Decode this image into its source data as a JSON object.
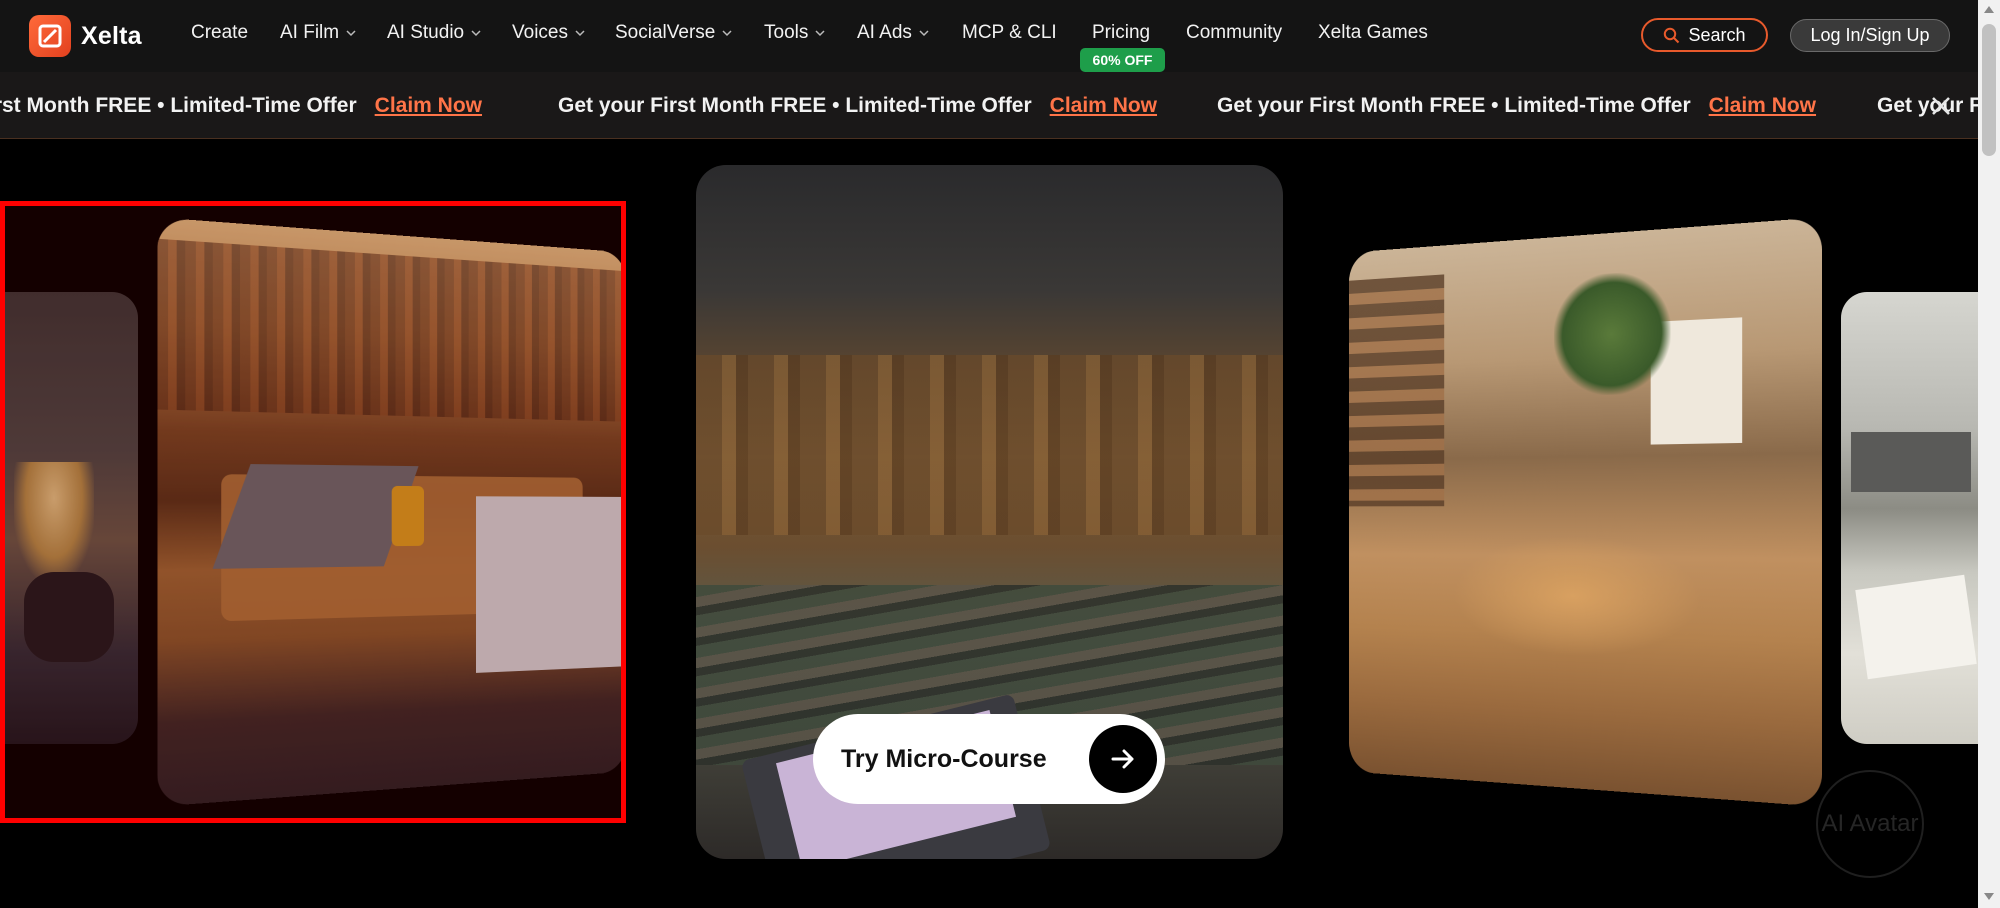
{
  "brand": {
    "name": "Xelta",
    "accent": "#e85a2c"
  },
  "nav": {
    "items": [
      {
        "label": "Create",
        "dropdown": false
      },
      {
        "label": "AI Film",
        "dropdown": true
      },
      {
        "label": "AI Studio",
        "dropdown": true
      },
      {
        "label": "Voices",
        "dropdown": true
      },
      {
        "label": "SocialVerse",
        "dropdown": true
      },
      {
        "label": "Tools",
        "dropdown": true
      },
      {
        "label": "AI Ads",
        "dropdown": true
      },
      {
        "label": "MCP & CLI",
        "dropdown": false
      },
      {
        "label": "Pricing",
        "dropdown": false
      },
      {
        "label": "Community",
        "dropdown": false
      },
      {
        "label": "Xelta Games",
        "dropdown": false
      }
    ],
    "pricing_badge": "60% OFF",
    "search_label": "Search",
    "login_label": "Log In/Sign Up"
  },
  "promo": {
    "segments": [
      {
        "text": "irst Month FREE • Limited-Time Offer",
        "link": "Claim Now"
      },
      {
        "text": "Get your First Month FREE • Limited-Time Offer",
        "link": "Claim Now"
      },
      {
        "text": "Get your First Month FREE • Limited-Time Offer",
        "link": "Claim Now"
      },
      {
        "text": "Get your F",
        "link": ""
      }
    ]
  },
  "carousel": {
    "cta_label": "Try Micro-Course",
    "slides": [
      "library-study-group",
      "lecture-hall",
      "workshop-circle",
      "study-room"
    ]
  },
  "floating": {
    "avatar_label": "AI Avatar"
  },
  "colors": {
    "badge_green": "#1e9e4a",
    "selection_red": "#ff0000"
  }
}
